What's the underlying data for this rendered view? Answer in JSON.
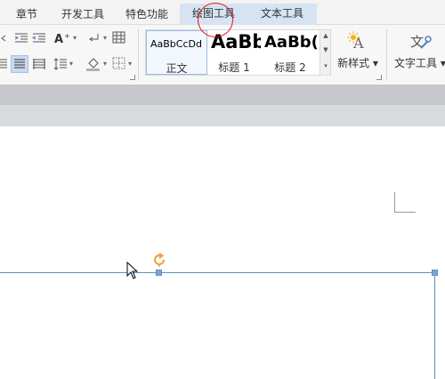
{
  "tabs": [
    {
      "label": "章节",
      "contextual": false
    },
    {
      "label": "开发工具",
      "contextual": false
    },
    {
      "label": "特色功能",
      "contextual": false
    },
    {
      "label": "绘图工具",
      "contextual": true
    },
    {
      "label": "文本工具",
      "contextual": true
    }
  ],
  "ribbon": {
    "styles": [
      {
        "sample": "AaBbCcDd",
        "label": "正文"
      },
      {
        "sample": "AaBb",
        "label": "标题 1"
      },
      {
        "sample": "AaBb(",
        "label": "标题 2"
      }
    ],
    "new_style_label": "新样式",
    "text_tools_label": "文字工具"
  },
  "colors": {
    "highlight_circle": "#e0161a",
    "selection_line": "#5f8fbf",
    "rotate_handle": "#f0a030",
    "context_tab": "#d6e3f3"
  }
}
